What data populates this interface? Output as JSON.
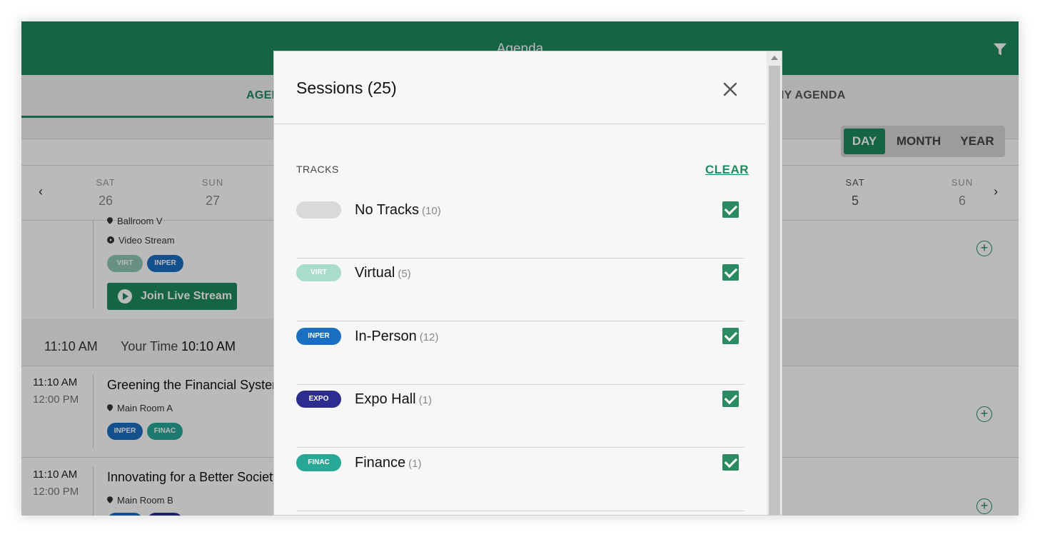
{
  "header": {
    "title": "Agenda",
    "filter_icon": "filter-icon"
  },
  "tabs": [
    {
      "label": "AGENDA"
    },
    {
      "label": "MY AGENDA"
    }
  ],
  "view_toggle": {
    "day": "DAY",
    "month": "MONTH",
    "year": "YEAR",
    "selected": "DAY"
  },
  "date_strip": {
    "days": [
      {
        "dow": "SAT",
        "num": "26"
      },
      {
        "dow": "SUN",
        "num": "27"
      },
      {
        "dow": "SAT",
        "num": "5"
      },
      {
        "dow": "SUN",
        "num": "6"
      }
    ]
  },
  "sessions": {
    "first": {
      "location": "Ballroom V",
      "stream": "Video Stream",
      "chips": [
        "VIRT",
        "INPER"
      ],
      "join_label": "Join Live Stream"
    },
    "slot": {
      "time": "11:10 AM",
      "your_time_label": "Your Time",
      "your_time": "10:10 AM"
    },
    "items": [
      {
        "start": "11:10 AM",
        "end": "12:00 PM",
        "title": "Greening the Financial System",
        "location": "Main Room A",
        "chips": [
          "INPER",
          "FINAC"
        ]
      },
      {
        "start": "11:10 AM",
        "end": "12:00 PM",
        "title": "Innovating for a Better Society",
        "location": "Main Room B",
        "chips": []
      }
    ]
  },
  "modal": {
    "title": "Sessions (25)",
    "tracks_label": "TRACKS",
    "clear_label": "CLEAR",
    "tracks": [
      {
        "chip": "",
        "name": "No Tracks",
        "count": "(10)",
        "color": "#d9d9d9",
        "checked": true
      },
      {
        "chip": "VIRT",
        "name": "Virtual",
        "count": "(5)",
        "color": "#a9dccc",
        "checked": true
      },
      {
        "chip": "INPER",
        "name": "In-Person",
        "count": "(12)",
        "color": "#1a6fc2",
        "checked": true
      },
      {
        "chip": "EXPO",
        "name": "Expo Hall",
        "count": "(1)",
        "color": "#2b2d8f",
        "checked": true
      },
      {
        "chip": "FINAC",
        "name": "Finance",
        "count": "(1)",
        "color": "#29a897",
        "checked": true
      }
    ]
  },
  "colors": {
    "brand": "#1e8a5f",
    "checkbox": "#2b8a62"
  }
}
